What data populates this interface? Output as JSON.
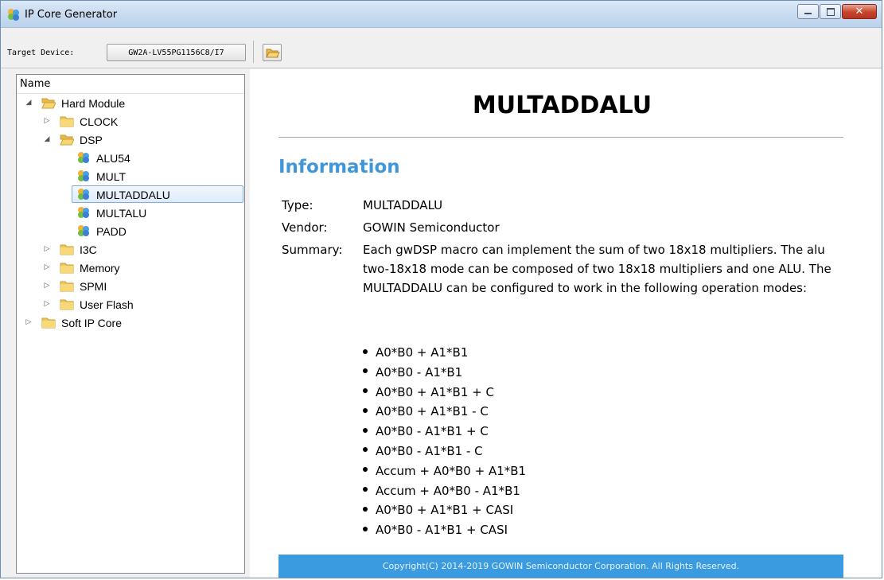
{
  "window": {
    "title": "IP Core Generator"
  },
  "toolbar": {
    "target_device_label": "Target Device:",
    "target_device_value": "GW2A-LV55PG1156C8/I7"
  },
  "tree": {
    "column_header": "Name",
    "items": [
      {
        "label": "Hard Module",
        "level": 0,
        "expanded": true,
        "icon": "folder-open-icon"
      },
      {
        "label": "CLOCK",
        "level": 1,
        "expanded": false,
        "icon": "folder-icon"
      },
      {
        "label": "DSP",
        "level": 1,
        "expanded": true,
        "icon": "folder-open-icon"
      },
      {
        "label": "ALU54",
        "level": 2,
        "icon": "ip-core-icon"
      },
      {
        "label": "MULT",
        "level": 2,
        "icon": "ip-core-icon"
      },
      {
        "label": "MULTADDALU",
        "level": 2,
        "icon": "ip-core-icon",
        "selected": true
      },
      {
        "label": "MULTALU",
        "level": 2,
        "icon": "ip-core-icon"
      },
      {
        "label": "PADD",
        "level": 2,
        "icon": "ip-core-icon"
      },
      {
        "label": "I3C",
        "level": 1,
        "expanded": false,
        "icon": "folder-icon"
      },
      {
        "label": "Memory",
        "level": 1,
        "expanded": false,
        "icon": "folder-icon"
      },
      {
        "label": "SPMI",
        "level": 1,
        "expanded": false,
        "icon": "folder-icon"
      },
      {
        "label": "User Flash",
        "level": 1,
        "expanded": false,
        "icon": "folder-icon"
      },
      {
        "label": "Soft IP Core",
        "level": 0,
        "expanded": false,
        "icon": "folder-icon"
      }
    ]
  },
  "content": {
    "title": "MULTADDALU",
    "section_title": "Information",
    "type_label": "Type:",
    "type_value": "MULTADDALU",
    "vendor_label": "Vendor:",
    "vendor_value": "GOWIN Semiconductor",
    "summary_label": "Summary:",
    "summary_value": "Each gwDSP macro can implement the sum of two 18x18 multipliers. The alu two-18x18 mode can be composed of two 18x18 multipliers and one ALU. The MULTADDALU can be configured to work in the following operation modes:",
    "modes": [
      "A0*B0 + A1*B1",
      "A0*B0 - A1*B1",
      "A0*B0 + A1*B1 + C",
      "A0*B0 + A1*B1 - C",
      "A0*B0 - A1*B1 + C",
      "A0*B0 - A1*B1 - C",
      "Accum + A0*B0 + A1*B1",
      "Accum + A0*B0 - A1*B1",
      "A0*B0 + A1*B1 + CASI",
      "A0*B0 - A1*B1 + CASI"
    ],
    "footer": "Copyright(C) 2014-2019 GOWIN Semiconductor Corporation. All Rights Reserved."
  },
  "colors": {
    "accent": "#3f97d9",
    "footer_bg": "#3a9be0",
    "selection_border": "#84acdd"
  }
}
